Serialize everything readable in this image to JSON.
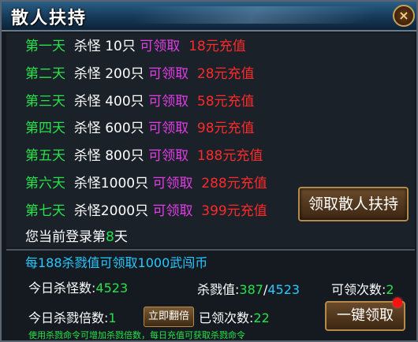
{
  "title": "散人扶持",
  "close_glyph": "×",
  "rows": [
    {
      "day": "第一天",
      "task": "杀怪 10只",
      "claim": "可领取",
      "reward": "18元充值"
    },
    {
      "day": "第二天",
      "task": "杀怪 200只",
      "claim": "可领取",
      "reward": "28元充值"
    },
    {
      "day": "第三天",
      "task": "杀怪 400只",
      "claim": "可领取",
      "reward": "58元充值"
    },
    {
      "day": "第四天",
      "task": "杀怪 600只",
      "claim": "可领取",
      "reward": "98元充值"
    },
    {
      "day": "第五天",
      "task": "杀怪 800只",
      "claim": "可领取",
      "reward": "188元充值"
    },
    {
      "day": "第六天",
      "task": "杀怪1000只",
      "claim": "可领取",
      "reward": "288元充值"
    },
    {
      "day": "第七天",
      "task": "杀怪2000只",
      "claim": "可领取",
      "reward": "399元充值"
    }
  ],
  "login": {
    "prefix": "您当前登录第",
    "day": "8",
    "suffix": "天"
  },
  "claim_support_button": "领取散人扶持",
  "rate_text": "每188杀戮值可领取1000武闯币",
  "stats": {
    "kill_label": "今日杀怪数:",
    "kill_value": "4523",
    "slaughter_label": "杀戮值:",
    "slaughter_current": "387",
    "slaughter_sep": "/",
    "slaughter_max": "4523",
    "claimable_label": "可领次数:",
    "claimable_value": "2",
    "multiplier_label": "今日杀戮倍数:",
    "multiplier_value": "1",
    "claimed_label": "已领次数:",
    "claimed_value": "22"
  },
  "flip_button": "立即翻倍",
  "onekey_button": "一键领取",
  "tip": "使用杀戮命令可增加杀戮倍数，每日充值可获取杀戮命令",
  "colors": {
    "day": "#27e24a",
    "claim": "#e23de6",
    "reward": "#ff2a2a",
    "info": "#28c8ff"
  }
}
